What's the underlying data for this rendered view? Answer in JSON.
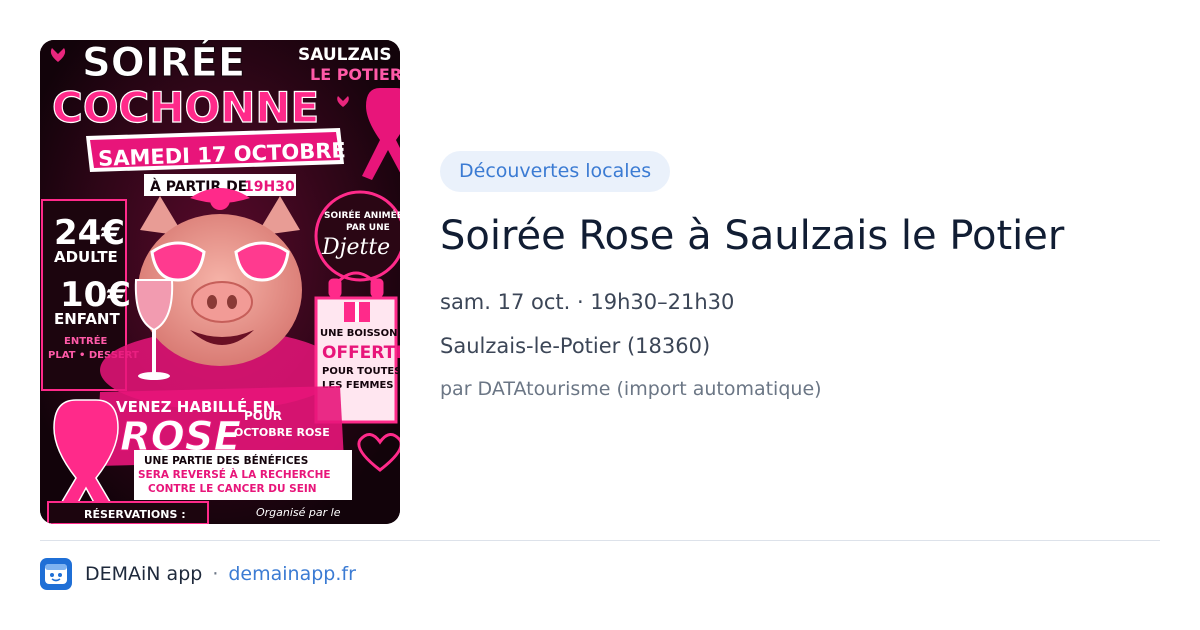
{
  "poster": {
    "headline_1": "SOIRÉE",
    "headline_2": "COCHONNE",
    "town_1": "SAULZAIS",
    "town_2": "LE POTIER",
    "date": "SAMEDI 17 OCTOBRE",
    "time_prefix": "À PARTIR DE",
    "time": "19H30",
    "dj_1": "SOIRÉE ANIMÉE",
    "dj_2": "PAR UNE",
    "dj_name": "Djette",
    "price_adult": "24€",
    "price_adult_label": "ADULTE",
    "price_child": "10€",
    "price_child_label": "ENFANT",
    "menu_1": "ENTRÉE",
    "menu_2": "PLAT • DESSERT",
    "drink_1": "UNE BOISSON",
    "drink_2": "OFFERTE",
    "drink_3": "POUR TOUTES",
    "drink_4": "LES FEMMES !",
    "dress_1": "VENEZ HABILLÉ EN",
    "dress_2": "ROSE",
    "dress_3": "POUR",
    "dress_4": "OCTOBRE ROSE",
    "charity_1": "UNE PARTIE DES BÉNÉFICES",
    "charity_2": "SERA REVERSÉ À LA RECHERCHE",
    "charity_3": "CONTRE LE CANCER DU SEIN",
    "reservations": "RÉSERVATIONS :",
    "organizer": "Organisé par le",
    "colors": {
      "background": "#14040c",
      "pink": "#ff2a8a",
      "hot_pink": "#e8157a",
      "white": "#ffffff"
    }
  },
  "category": "Découvertes locales",
  "title": "Soirée Rose à Saulzais le Potier",
  "date_time": "sam. 17 oct. · 19h30–21h30",
  "location": "Saulzais-le-Potier (18360)",
  "source": "par DATAtourisme (import automatique)",
  "footer": {
    "app_name": "DEMAiN app",
    "separator": "·",
    "domain": "demainapp.fr",
    "icon": "demain-app-icon"
  },
  "colors": {
    "badge_bg": "#eaf1fb",
    "accent": "#3b7bd3",
    "title": "#111d33",
    "meta": "#3c4657",
    "muted": "#6b7685"
  }
}
